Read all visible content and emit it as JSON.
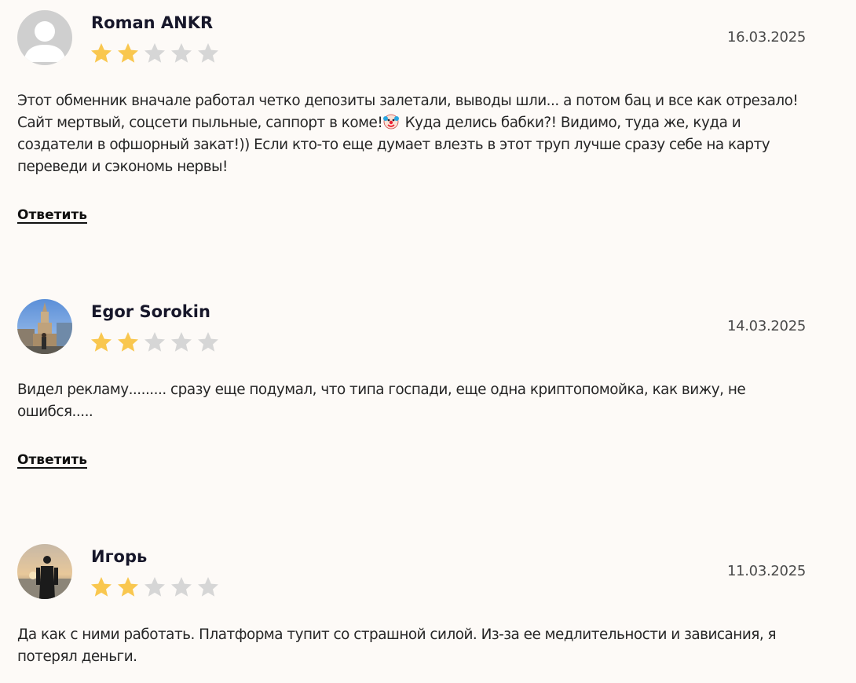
{
  "reviews": [
    {
      "author": "Roman ANKR",
      "date": "16.03.2025",
      "rating": 2,
      "max_rating": 5,
      "avatar": "default-user-icon",
      "text_before_emoji": "Этот обменник вначале работал четко депозиты залетали, выводы шли... а потом бац и все как отрезало! Сайт мертвый, соцсети пыльные, саппорт в коме!",
      "emoji": "clown-face-icon",
      "text_after_emoji": " Куда делись бабки?! Видимо, туда же, куда и создатели в офшорный закат!)) Если кто-то еще думает влезть в этот труп лучше сразу себе на карту переведи и сэкономь нервы!",
      "reply_label": "Ответить"
    },
    {
      "author": "Egor Sorokin",
      "date": "14.03.2025",
      "rating": 2,
      "max_rating": 5,
      "avatar": "photo-tower-avatar",
      "text": "Видел рекламу......... сразу еще подумал, что типа госпади, еще одна криптопомойка, как вижу, не ошибся.....",
      "reply_label": "Ответить"
    },
    {
      "author": "Игорь",
      "date": "11.03.2025",
      "rating": 2,
      "max_rating": 5,
      "avatar": "photo-sunset-avatar",
      "text": "Да как с ними работать. Платформа тупит со страшной силой. Из-за ее медлительности и зависания, я потерял деньги."
    }
  ],
  "colors": {
    "background": "#fdfaf7",
    "star_filled": "#f9c74f",
    "star_empty": "#d6d6d6"
  }
}
